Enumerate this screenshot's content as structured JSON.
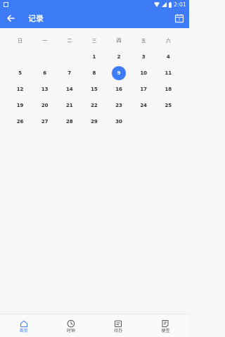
{
  "status_bar": {
    "time": "2:01"
  },
  "app_bar": {
    "title": "记录"
  },
  "calendar": {
    "weekdays": [
      "日",
      "一",
      "二",
      "三",
      "四",
      "五",
      "六"
    ],
    "leading_blanks": 3,
    "days": [
      "1",
      "2",
      "3",
      "4",
      "5",
      "6",
      "7",
      "8",
      "9",
      "10",
      "11",
      "12",
      "13",
      "14",
      "15",
      "16",
      "17",
      "18",
      "19",
      "20",
      "21",
      "22",
      "23",
      "24",
      "25",
      "26",
      "27",
      "28",
      "29",
      "30"
    ],
    "selected_day": "9"
  },
  "bottom_nav": {
    "items": [
      {
        "label": "首页",
        "icon": "home-icon",
        "active": true
      },
      {
        "label": "时钟",
        "icon": "clock-icon",
        "active": false
      },
      {
        "label": "待办",
        "icon": "todo-icon",
        "active": false
      },
      {
        "label": "便签",
        "icon": "note-icon",
        "active": false
      }
    ]
  },
  "colors": {
    "accent": "#3d7bf7",
    "background": "#f7f7f7"
  }
}
